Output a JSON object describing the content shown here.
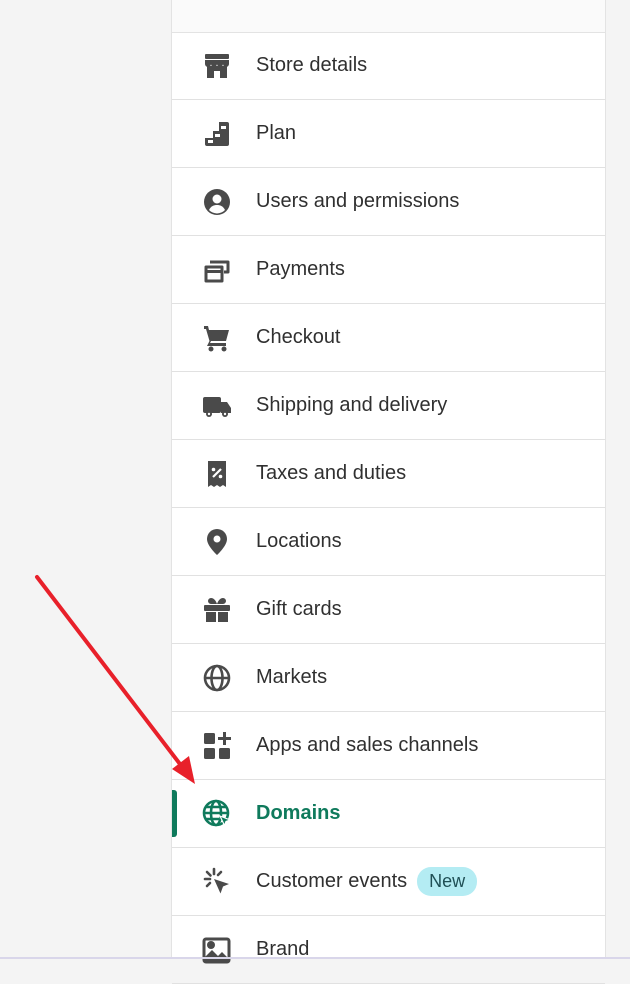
{
  "nav": {
    "items": [
      {
        "label": "Store details",
        "icon": "store-icon"
      },
      {
        "label": "Plan",
        "icon": "plan-icon"
      },
      {
        "label": "Users and permissions",
        "icon": "user-circle-icon"
      },
      {
        "label": "Payments",
        "icon": "payments-icon"
      },
      {
        "label": "Checkout",
        "icon": "cart-icon"
      },
      {
        "label": "Shipping and delivery",
        "icon": "truck-icon"
      },
      {
        "label": "Taxes and duties",
        "icon": "tax-receipt-icon"
      },
      {
        "label": "Locations",
        "icon": "location-pin-icon"
      },
      {
        "label": "Gift cards",
        "icon": "gift-icon"
      },
      {
        "label": "Markets",
        "icon": "globe-markets-icon"
      },
      {
        "label": "Apps and sales channels",
        "icon": "apps-icon"
      },
      {
        "label": "Domains",
        "icon": "globe-cursor-icon",
        "active": true
      },
      {
        "label": "Customer events",
        "icon": "sparkle-cursor-icon",
        "badge": "New"
      },
      {
        "label": "Brand",
        "icon": "image-icon"
      }
    ]
  },
  "colors": {
    "active": "#0f7a5c",
    "text": "#303030",
    "icon": "#4a4a4a",
    "badge_bg": "#b4ecf3",
    "arrow": "#e8202a"
  }
}
